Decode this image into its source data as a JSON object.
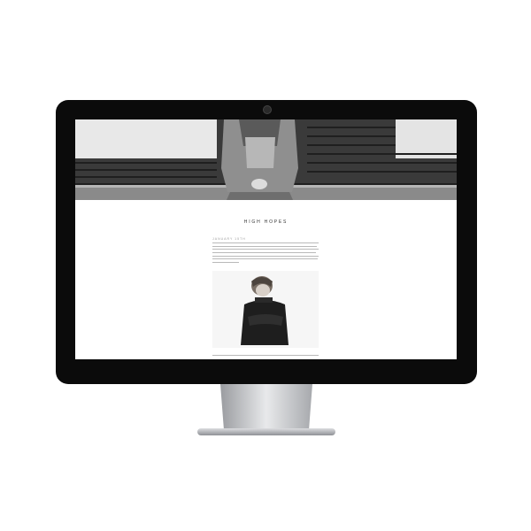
{
  "blog": {
    "title": "HIGH HOPES",
    "post_date": "JANUARY 15TH"
  },
  "device": {
    "frame_color": "#0b0b0b",
    "screen_bg": "#ffffff"
  }
}
